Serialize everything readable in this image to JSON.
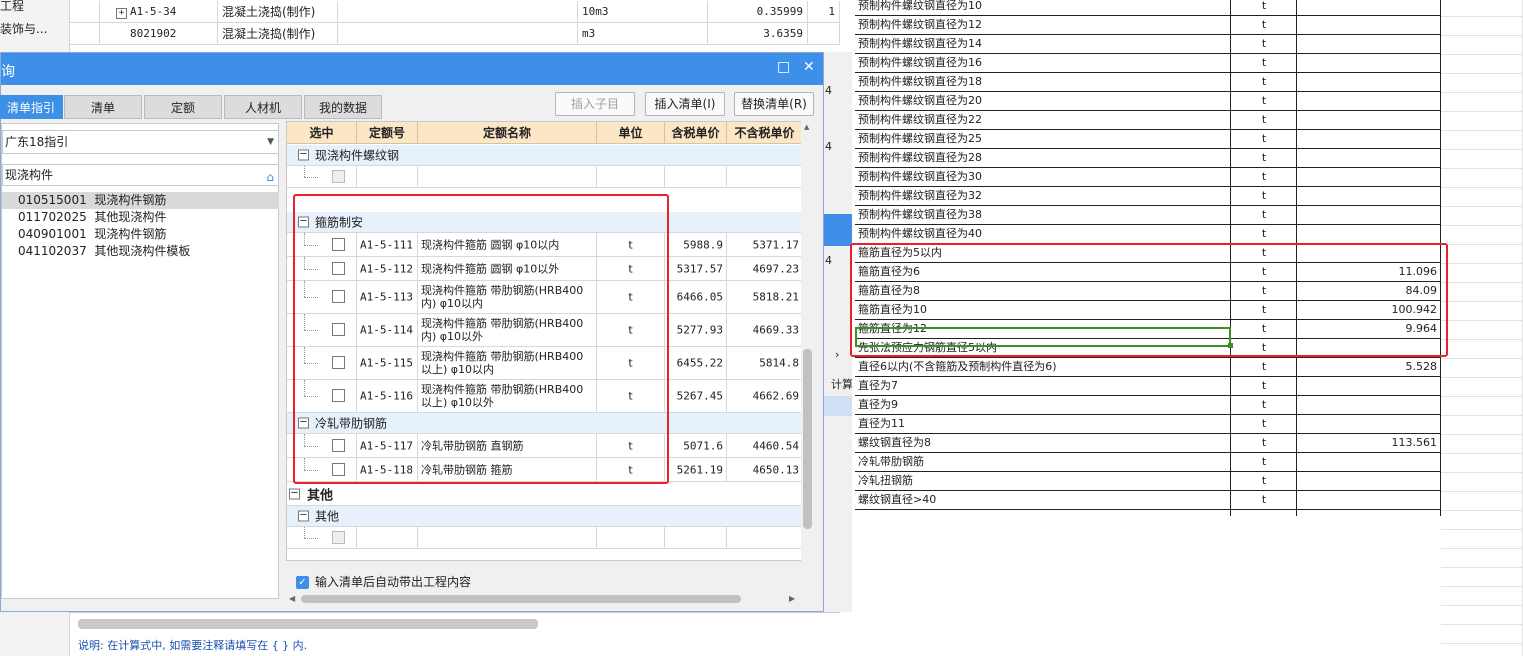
{
  "bg_left": {
    "items": [
      "工程",
      "装饰与..."
    ]
  },
  "bg_table": {
    "rows": [
      {
        "code": "A1-5-34",
        "name": "混凝土浇捣(制作)",
        "unit": "10m3",
        "qty": "0.35999",
        "extra": "1"
      },
      {
        "code": "8021902",
        "name": "混凝土浇捣(制作)",
        "unit": "m3",
        "qty": "3.6359",
        "extra": ""
      }
    ]
  },
  "bg_strip": {
    "nums": [
      "4",
      "4",
      "4"
    ],
    "label": "计算"
  },
  "bg_note": "说明: 在计算式中, 如需要注释请填写在 { } 内.",
  "dialog": {
    "title": "询",
    "tabs": [
      "清单指引",
      "清单",
      "定额",
      "人材机",
      "我的数据"
    ],
    "buttons": {
      "insert_child": "插入子目",
      "insert_list": "插入清单(I)",
      "replace_list": "替换清单(R)"
    },
    "combo_value": "广东18指引",
    "search_value": "现浇构件",
    "list": [
      {
        "code": "010515001",
        "name": "现浇构件钢筋",
        "selected": true
      },
      {
        "code": "011702025",
        "name": "其他现浇构件",
        "selected": false
      },
      {
        "code": "040901001",
        "name": "现浇构件钢筋",
        "selected": false
      },
      {
        "code": "041102037",
        "name": "其他现浇构件模板",
        "selected": false
      }
    ],
    "columns": [
      "选中",
      "定额号",
      "定额名称",
      "单位",
      "含税单价",
      "不含税单价"
    ],
    "groups": [
      {
        "label": "现浇构件螺纹钢",
        "rows": [
          {
            "code": "",
            "name1": "",
            "name2": "",
            "unit": "",
            "tax": "",
            "notax": "",
            "disabled": true
          }
        ]
      },
      {
        "label": "箍筋制安",
        "rows": [
          {
            "code": "A1-5-111",
            "name1": "现浇构件箍筋 圆钢 φ10以内",
            "name2": "",
            "unit": "t",
            "tax": "5988.9",
            "notax": "5371.17"
          },
          {
            "code": "A1-5-112",
            "name1": "现浇构件箍筋 圆钢 φ10以外",
            "name2": "",
            "unit": "t",
            "tax": "5317.57",
            "notax": "4697.23"
          },
          {
            "code": "A1-5-113",
            "name1": "现浇构件箍筋 带肋钢筋(HRB400",
            "name2": "内) φ10以内",
            "unit": "t",
            "tax": "6466.05",
            "notax": "5818.21"
          },
          {
            "code": "A1-5-114",
            "name1": "现浇构件箍筋 带肋钢筋(HRB400",
            "name2": "内) φ10以外",
            "unit": "t",
            "tax": "5277.93",
            "notax": "4669.33"
          },
          {
            "code": "A1-5-115",
            "name1": "现浇构件箍筋 带肋钢筋(HRB400",
            "name2": "以上) φ10以内",
            "unit": "t",
            "tax": "6455.22",
            "notax": "5814.8"
          },
          {
            "code": "A1-5-116",
            "name1": "现浇构件箍筋 带肋钢筋(HRB400",
            "name2": "以上) φ10以外",
            "unit": "t",
            "tax": "5267.45",
            "notax": "4662.69"
          }
        ]
      },
      {
        "label": "冷轧带肋钢筋",
        "rows": [
          {
            "code": "A1-5-117",
            "name1": "冷轧带肋钢筋 直钢筋",
            "name2": "",
            "unit": "t",
            "tax": "5071.6",
            "notax": "4460.54"
          },
          {
            "code": "A1-5-118",
            "name1": "冷轧带肋钢筋 箍筋",
            "name2": "",
            "unit": "t",
            "tax": "5261.19",
            "notax": "4650.13"
          }
        ]
      }
    ],
    "other_header": "其他",
    "other_group": {
      "label": "其他"
    },
    "auto_option": "输入清单后自动带出工程内容"
  },
  "sheet": {
    "rows": [
      {
        "name": "预制构件螺纹钢直径为10",
        "unit": "t",
        "val": ""
      },
      {
        "name": "预制构件螺纹钢直径为12",
        "unit": "t",
        "val": ""
      },
      {
        "name": "预制构件螺纹钢直径为14",
        "unit": "t",
        "val": ""
      },
      {
        "name": "预制构件螺纹钢直径为16",
        "unit": "t",
        "val": ""
      },
      {
        "name": "预制构件螺纹钢直径为18",
        "unit": "t",
        "val": ""
      },
      {
        "name": "预制构件螺纹钢直径为20",
        "unit": "t",
        "val": ""
      },
      {
        "name": "预制构件螺纹钢直径为22",
        "unit": "t",
        "val": ""
      },
      {
        "name": "预制构件螺纹钢直径为25",
        "unit": "t",
        "val": ""
      },
      {
        "name": "预制构件螺纹钢直径为28",
        "unit": "t",
        "val": ""
      },
      {
        "name": "预制构件螺纹钢直径为30",
        "unit": "t",
        "val": ""
      },
      {
        "name": "预制构件螺纹钢直径为32",
        "unit": "t",
        "val": ""
      },
      {
        "name": "预制构件螺纹钢直径为38",
        "unit": "t",
        "val": ""
      },
      {
        "name": "预制构件螺纹钢直径为40",
        "unit": "t",
        "val": ""
      },
      {
        "name": "箍筋直径为5以内",
        "unit": "t",
        "val": ""
      },
      {
        "name": "箍筋直径为6",
        "unit": "t",
        "val": "11.096"
      },
      {
        "name": "箍筋直径为8",
        "unit": "t",
        "val": "84.09"
      },
      {
        "name": "箍筋直径为10",
        "unit": "t",
        "val": "100.942"
      },
      {
        "name": "箍筋直径为12",
        "unit": "t",
        "val": "9.964"
      },
      {
        "name": "先张法预应力钢筋直径5以内",
        "unit": "t",
        "val": ""
      },
      {
        "name": "直径6以内(不含箍筋及预制构件直径为6)",
        "unit": "t",
        "val": "5.528"
      },
      {
        "name": "直径为7",
        "unit": "t",
        "val": ""
      },
      {
        "name": "直径为9",
        "unit": "t",
        "val": ""
      },
      {
        "name": "直径为11",
        "unit": "t",
        "val": ""
      },
      {
        "name": "螺纹钢直径为8",
        "unit": "t",
        "val": "113.561"
      },
      {
        "name": "冷轧带肋钢筋",
        "unit": "t",
        "val": ""
      },
      {
        "name": "冷轧扭钢筋",
        "unit": "t",
        "val": ""
      },
      {
        "name": "螺纹钢直径>40",
        "unit": "t",
        "val": ""
      }
    ]
  },
  "colors": {
    "accent": "#3d8fe8",
    "highlight_box": "#e8212b",
    "selected_cell": "#3e8e2c",
    "grid_header": "#fbe6c6"
  }
}
